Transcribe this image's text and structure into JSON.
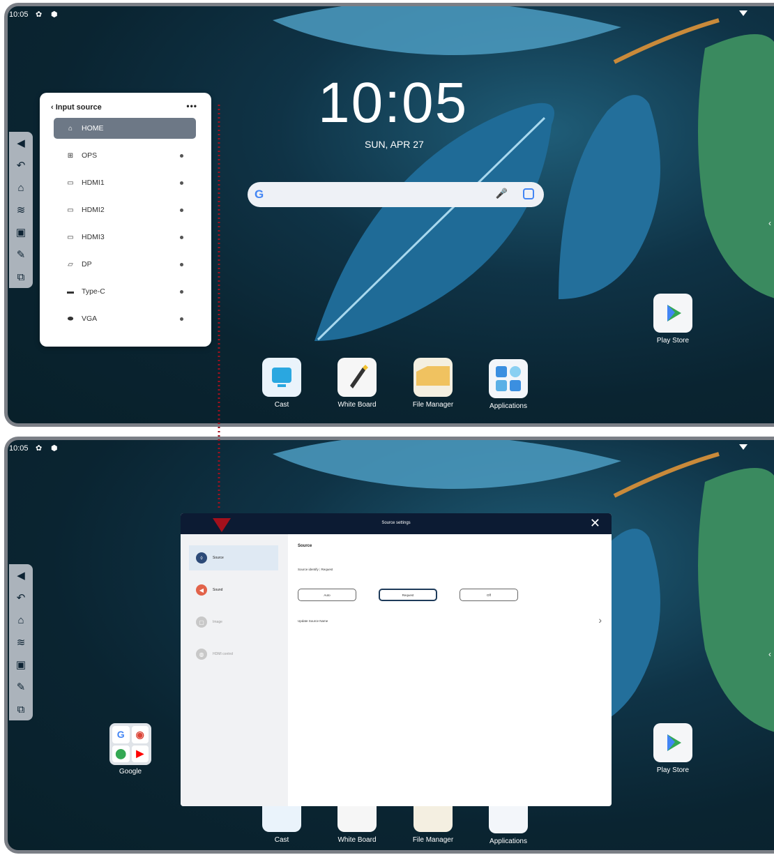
{
  "status": {
    "time": "10:05"
  },
  "home": {
    "clock": "10:05",
    "date": "SUN, APR 27"
  },
  "search": {
    "g_letter": "G"
  },
  "dock": {
    "cast": "Cast",
    "whiteboard": "White Board",
    "file_manager": "File Manager",
    "applications": "Applications",
    "play_store": "Play Store"
  },
  "folder": {
    "label": "Google"
  },
  "input_source": {
    "title": "Input source",
    "menu": "•••",
    "items": [
      {
        "label": "HOME",
        "icon": "home-icon"
      },
      {
        "label": "OPS",
        "icon": "windows-icon"
      },
      {
        "label": "HDMI1",
        "icon": "hdmi-icon"
      },
      {
        "label": "HDMI2",
        "icon": "hdmi-icon"
      },
      {
        "label": "HDMI3",
        "icon": "hdmi-icon"
      },
      {
        "label": "DP",
        "icon": "displayport-icon"
      },
      {
        "label": "Type-C",
        "icon": "usb-c-icon"
      },
      {
        "label": "VGA",
        "icon": "vga-icon"
      }
    ]
  },
  "source_settings": {
    "title": "Source settings",
    "nav": [
      {
        "label": "Source",
        "color": "#2c4a78"
      },
      {
        "label": "Sound",
        "color": "#e2634a"
      },
      {
        "label": "Image",
        "color": "#c8c8c8"
      },
      {
        "label": "HDMI control",
        "color": "#c8c8c8"
      }
    ],
    "heading": "Source",
    "identity_label": "Source identify",
    "identity_value": "Request",
    "options": [
      "Auto",
      "Request",
      "Off"
    ],
    "update_label": "Update Source Name"
  },
  "colors": {
    "accent": "#a3101c",
    "panel_active": "#6d7886",
    "dialog_bar": "#0c1b33"
  }
}
